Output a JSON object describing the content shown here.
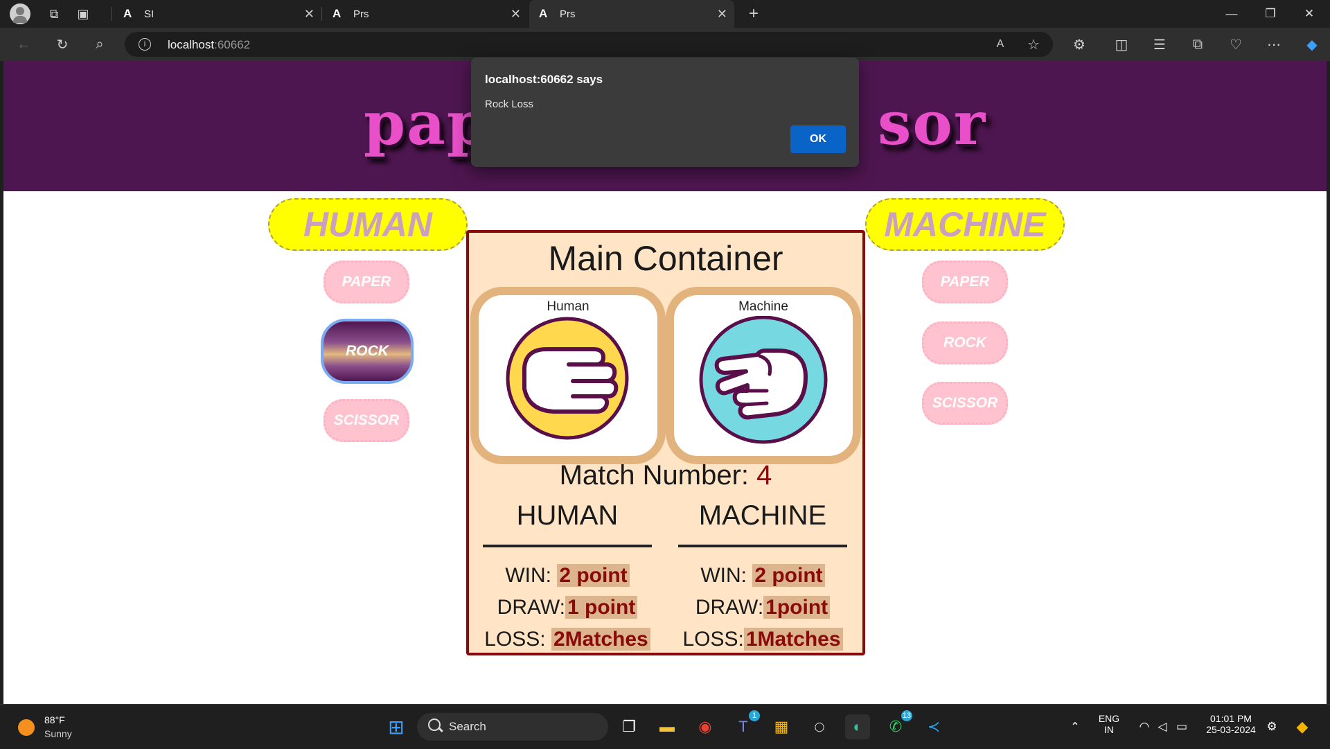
{
  "browser": {
    "tabs": [
      {
        "label": "SI"
      },
      {
        "label": "Prs"
      },
      {
        "label": "Prs"
      }
    ],
    "url_host": "localhost",
    "url_port": ":60662"
  },
  "page": {
    "banner_text_left": "pap",
    "banner_text_right": "sor",
    "human_title": "HUMAN",
    "machine_title": "MACHINE",
    "human_choices": [
      "PAPER",
      "ROCK",
      "SCISSOR"
    ],
    "machine_choices": [
      "PAPER",
      "ROCK",
      "SCISSOR"
    ],
    "selected_human_choice": "ROCK",
    "main": {
      "title": "Main Container",
      "human_card_label": "Human",
      "machine_card_label": "Machine",
      "match_label": "Match Number:",
      "match_number": "4",
      "human_header": "HUMAN",
      "machine_header": "MACHINE",
      "human_stats": {
        "win_label": "WIN:",
        "win_value": "2 point",
        "draw_label": "DRAW:",
        "draw_value": "1 point",
        "loss_label": "LOSS:",
        "loss_value": "2Matches"
      },
      "machine_stats": {
        "win_label": "WIN:",
        "win_value": "2 point",
        "draw_label": "DRAW:",
        "draw_value": "1point",
        "loss_label": "LOSS:",
        "loss_value": "1Matches"
      }
    }
  },
  "dialog": {
    "title": "localhost:60662 says",
    "message": "Rock Loss",
    "ok_label": "OK"
  },
  "taskbar": {
    "temperature": "88°F",
    "condition": "Sunny",
    "search_label": "Search",
    "teams_badge": "1",
    "whatsapp_badge": "13",
    "lang_line1": "ENG",
    "lang_line2": "IN",
    "time": "01:01 PM",
    "date": "25-03-2024"
  },
  "colors": {
    "banner": "#4e1650",
    "side_title": "#ffff00",
    "choice_button": "#ffc2cf",
    "main_bg": "#ffe4c6",
    "main_border": "#8a0a0a",
    "accent_value": "#8a0a0a",
    "dialog_button": "#0a63c6"
  }
}
